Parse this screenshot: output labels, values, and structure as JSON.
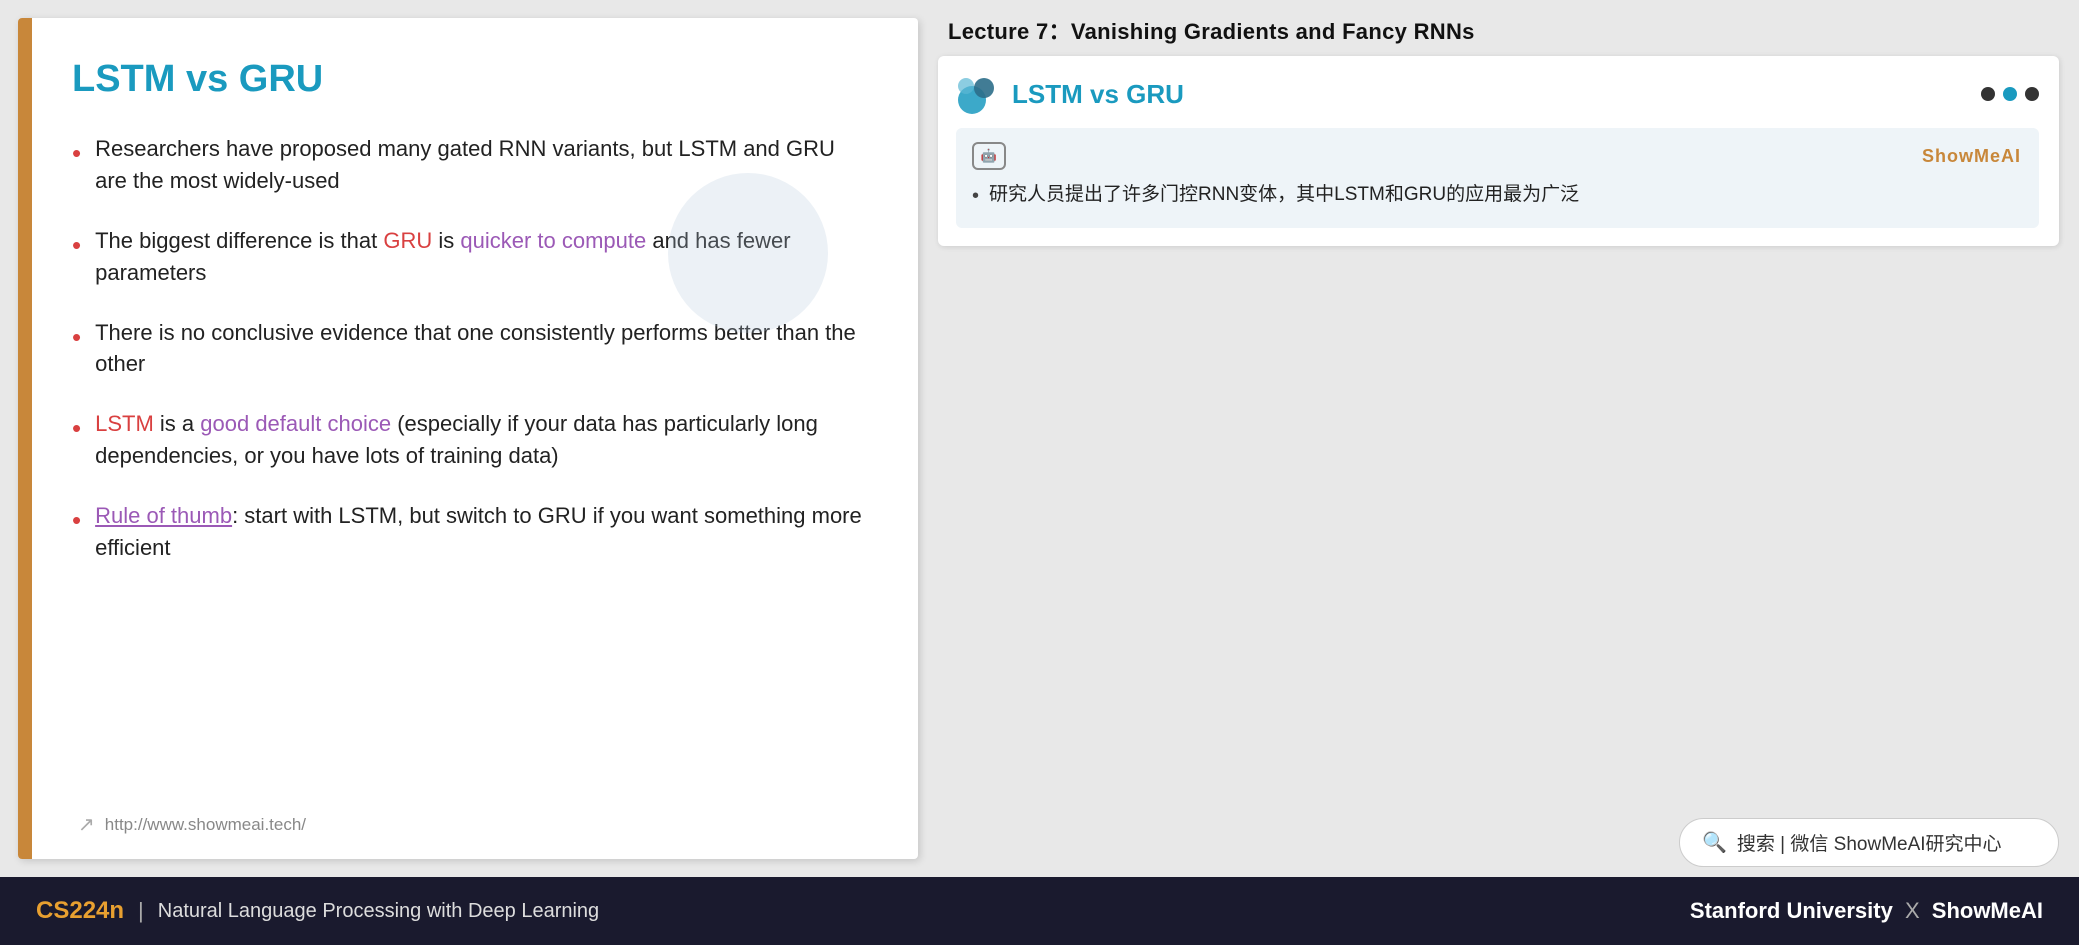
{
  "lecture_header": "Lecture 7：Vanishing Gradients and Fancy RNNs",
  "slide": {
    "title": "LSTM vs GRU",
    "accent_color": "#c8873a",
    "bullets": [
      {
        "id": 1,
        "parts": [
          {
            "text": "Researchers have proposed many gated RNN variants, but LSTM and GRU are the most widely-used",
            "style": "normal"
          }
        ]
      },
      {
        "id": 2,
        "parts": [
          {
            "text": "The biggest difference is that ",
            "style": "normal"
          },
          {
            "text": "GRU",
            "style": "red"
          },
          {
            "text": " is ",
            "style": "normal"
          },
          {
            "text": "quicker to compute",
            "style": "purple"
          },
          {
            "text": " and has fewer parameters",
            "style": "normal"
          }
        ]
      },
      {
        "id": 3,
        "parts": [
          {
            "text": "There is no conclusive evidence that one consistently performs better than the other",
            "style": "normal"
          }
        ]
      },
      {
        "id": 4,
        "parts": [
          {
            "text": "LSTM",
            "style": "red"
          },
          {
            "text": " is a ",
            "style": "normal"
          },
          {
            "text": "good default choice",
            "style": "purple"
          },
          {
            "text": " (especially if your data has particularly long dependencies, or you have lots of training data)",
            "style": "normal"
          }
        ]
      },
      {
        "id": 5,
        "parts": [
          {
            "text": "Rule of thumb",
            "style": "purple-link"
          },
          {
            "text": ": start with LSTM, but switch to GRU if you want something more efficient",
            "style": "normal"
          }
        ]
      }
    ],
    "footer_url": "http://www.showmeai.tech/"
  },
  "preview": {
    "title": "LSTM vs GRU",
    "dots": [
      "inactive",
      "active",
      "inactive"
    ]
  },
  "translation": {
    "ai_badge": "AI",
    "brand_label": "ShowMeAI",
    "bullet": "研究人员提出了许多门控RNN变体，其中LSTM和GRU的应用最为广泛"
  },
  "search_bar": {
    "placeholder": "搜索 | 微信 ShowMeAI研究中心",
    "icon": "🔍"
  },
  "bottom_bar": {
    "course_code": "CS224n",
    "separator": "|",
    "course_name": "Natural Language Processing with Deep Learning",
    "right_text": "Stanford University",
    "x_separator": "X",
    "brand": "ShowMeAI"
  }
}
